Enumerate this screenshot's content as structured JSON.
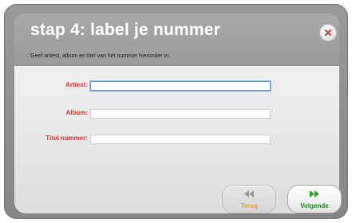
{
  "dialog": {
    "title": "stap 4: label je nummer",
    "instructions": "Geef artiest, album en titel van het nummer hieronder in."
  },
  "icons": {
    "close": "close-icon",
    "back": "rewind-icon",
    "next": "fast-forward-icon"
  },
  "form": {
    "fields": [
      {
        "label": "Artiest:",
        "value": "",
        "focused": true
      },
      {
        "label": "Album:",
        "value": "",
        "focused": false
      },
      {
        "label": "Titel nummer:",
        "value": "",
        "focused": false
      }
    ]
  },
  "navigation": {
    "back_label": "Terug",
    "back_enabled": false,
    "next_label": "Volgende",
    "next_enabled": true
  },
  "colors": {
    "label_red": "#e53333",
    "back_orange": "#e6a33c",
    "next_green": "#1a8f1a",
    "title_white": "#ffffff"
  }
}
